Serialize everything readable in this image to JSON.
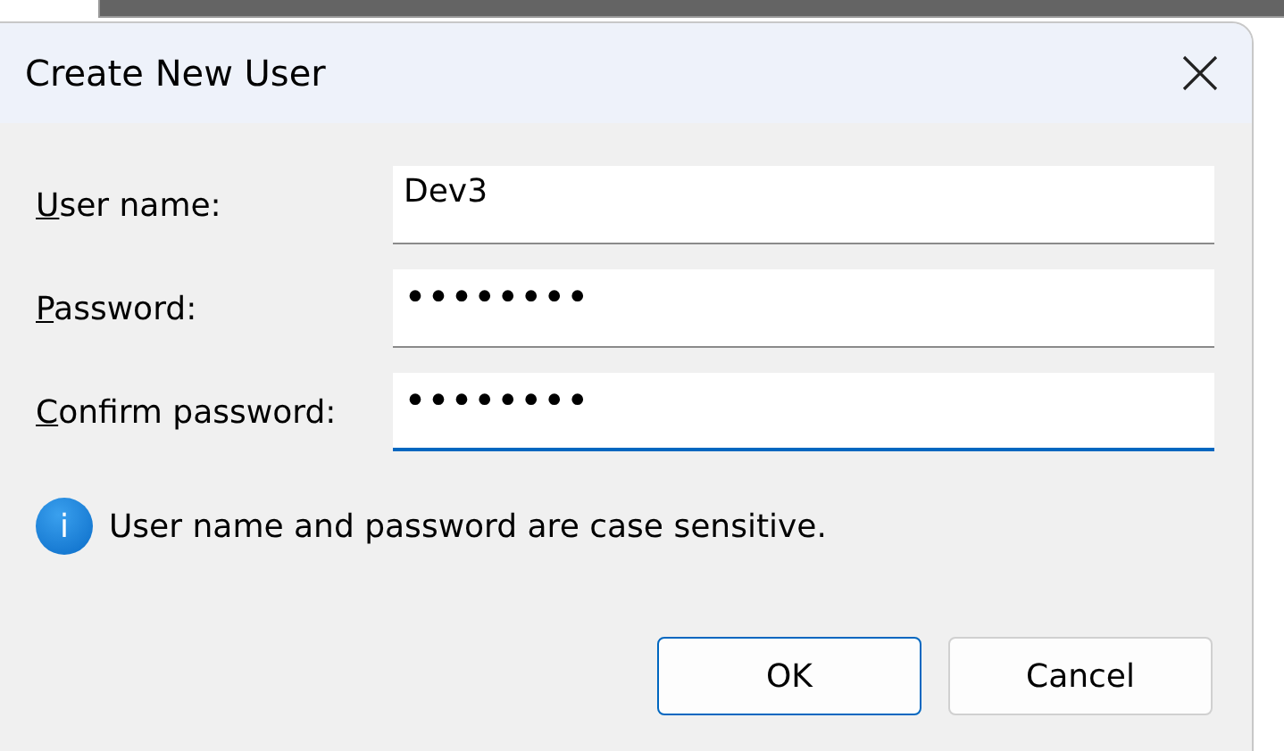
{
  "window": {
    "title": "Create New User"
  },
  "fields": [
    {
      "mnemonic": "U",
      "label_rest": "ser name:",
      "value": "Dev3",
      "focused": false
    },
    {
      "mnemonic": "P",
      "label_rest": "assword:",
      "value": "••••••••",
      "focused": false
    },
    {
      "mnemonic": "C",
      "label_rest": "onfirm password:",
      "value": "••••••••",
      "focused": true
    }
  ],
  "info": {
    "icon": "i",
    "text": "User name and password are case sensitive."
  },
  "buttons": [
    {
      "label": "OK",
      "default": true
    },
    {
      "label": "Cancel",
      "default": false
    }
  ]
}
